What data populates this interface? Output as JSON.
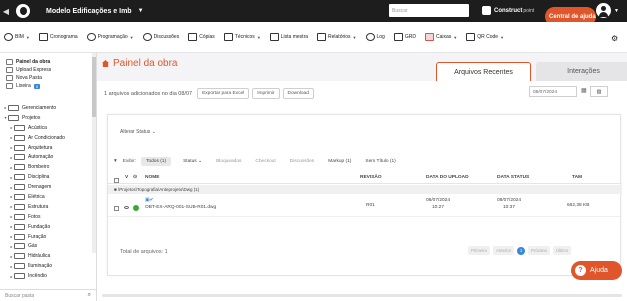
{
  "topbar": {
    "project": "Modelo Edificações e Imb",
    "search_placeholder": "Buscar",
    "brand": "Construct",
    "brand_sub": "point",
    "help": "Central de ajuda"
  },
  "toolbar": {
    "items": [
      {
        "label": "BIM",
        "dropdown": true
      },
      {
        "label": "Cronograma",
        "dropdown": false
      },
      {
        "label": "Programação",
        "dropdown": true
      },
      {
        "label": "Discussões",
        "dropdown": false
      },
      {
        "label": "Cópias",
        "dropdown": false
      },
      {
        "label": "Técnicos",
        "dropdown": true
      },
      {
        "label": "Lista mestra",
        "dropdown": false
      },
      {
        "label": "Relatórios",
        "dropdown": true
      },
      {
        "label": "Log",
        "dropdown": false
      },
      {
        "label": "GRD",
        "dropdown": false
      },
      {
        "label": "Caixas",
        "dropdown": true
      },
      {
        "label": "QR Code",
        "dropdown": true
      }
    ]
  },
  "sidebar": {
    "quick": [
      {
        "label": "Painel da obra",
        "bold": true
      },
      {
        "label": "Upload Express"
      },
      {
        "label": "Nova Pasta"
      },
      {
        "label": "Lixeira",
        "badge": "0"
      }
    ],
    "tree": [
      {
        "label": "Gerenciamento",
        "level": 0,
        "arrow": "▸"
      },
      {
        "label": "Projetos",
        "level": 0,
        "arrow": "▾"
      },
      {
        "label": "Acústica",
        "level": 1,
        "arrow": "▸"
      },
      {
        "label": "Ar Condicionado",
        "level": 1,
        "arrow": "▸"
      },
      {
        "label": "Arquitetura",
        "level": 1,
        "arrow": "▸"
      },
      {
        "label": "Automação",
        "level": 1,
        "arrow": "▸"
      },
      {
        "label": "Bombeiro",
        "level": 1,
        "arrow": "▸"
      },
      {
        "label": "Disciplina",
        "level": 1,
        "arrow": "▸"
      },
      {
        "label": "Drenagem",
        "level": 1,
        "arrow": "▸"
      },
      {
        "label": "Elétrica",
        "level": 1,
        "arrow": "▸"
      },
      {
        "label": "Estrutura",
        "level": 1,
        "arrow": "▸"
      },
      {
        "label": "Fotos",
        "level": 1,
        "arrow": "▸"
      },
      {
        "label": "Fundação",
        "level": 1,
        "arrow": "▸"
      },
      {
        "label": "Furação",
        "level": 1,
        "arrow": "▸"
      },
      {
        "label": "Gás",
        "level": 1,
        "arrow": "▸"
      },
      {
        "label": "Hidráulica",
        "level": 1,
        "arrow": "▸"
      },
      {
        "label": "Iluminação",
        "level": 1,
        "arrow": "▸"
      },
      {
        "label": "Incêndio",
        "level": 1,
        "arrow": "▸"
      }
    ],
    "search_placeholder": "Buscar pasta"
  },
  "main": {
    "title": "Painel da obra",
    "tabs": [
      {
        "label": "Arquivos Recentes",
        "active": true
      },
      {
        "label": "Interações",
        "active": false
      }
    ],
    "added_info": "1 arquivos adicionados no dia 08/07",
    "buttons": [
      "Exportar para Excel",
      "Imprimir",
      "Download"
    ],
    "date": "08/07/2024",
    "status_label": "Alterar Status",
    "filters": {
      "label": "Exibir:",
      "items": [
        {
          "label": "Todos (1)",
          "selected": true
        },
        {
          "label": "Status",
          "dropdown": true
        },
        {
          "label": "Bloqueados"
        },
        {
          "label": "Checkout"
        },
        {
          "label": "Discussões"
        },
        {
          "label": "Markup (1)",
          "dark": true
        },
        {
          "label": "Sem Título (1)",
          "dark": true
        }
      ]
    },
    "table": {
      "columns": [
        "V",
        "NOME",
        "REVISÃO",
        "DATA DO UPLOAD",
        "DATA STATUS",
        "TAM"
      ],
      "folder": "\\Projetos\\Topografia\\Anteprojeto\\Dwg (1)",
      "rows": [
        {
          "name": "OBT-EX-ARQ-001-SUB-R01.dwg",
          "revision": "R01",
          "upload_date": "08/07/2024",
          "upload_time": "10:27",
          "status_date": "08/07/2024",
          "status_time": "10:37",
          "size": "662,38 KB"
        }
      ]
    },
    "total": "Total de arquivos: 1",
    "pager": {
      "first": "Primeiro",
      "prev": "Anterior",
      "current": "1",
      "next": "Próxima",
      "last": "Último"
    }
  },
  "help_button": "Ajuda",
  "colors": {
    "accent": "#e0562a",
    "topbar": "#1d1d1d",
    "primary_blue": "#3a86d8",
    "ok_green": "#39a935"
  }
}
